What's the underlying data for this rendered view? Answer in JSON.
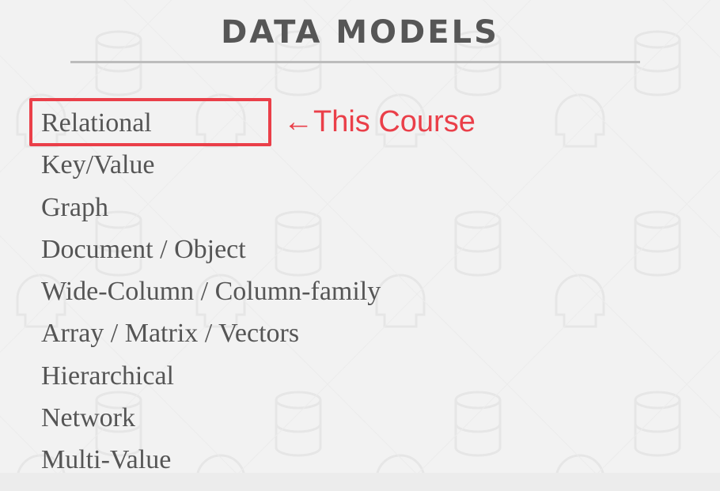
{
  "slide": {
    "title": "DATA MODELS",
    "items": [
      "Relational",
      "Key/Value",
      "Graph",
      "Document / Object",
      "Wide-Column / Column-family",
      "Array / Matrix / Vectors",
      "Hierarchical",
      "Network",
      "Multi-Value"
    ],
    "highlighted_item": "Relational",
    "annotation": "←This Course",
    "colors": {
      "accent": "#ea3f49",
      "text": "#555555",
      "background": "#f2f2f2",
      "rule": "#bcbcbc"
    },
    "background_icons": [
      "database-icon",
      "skull-icon"
    ]
  }
}
